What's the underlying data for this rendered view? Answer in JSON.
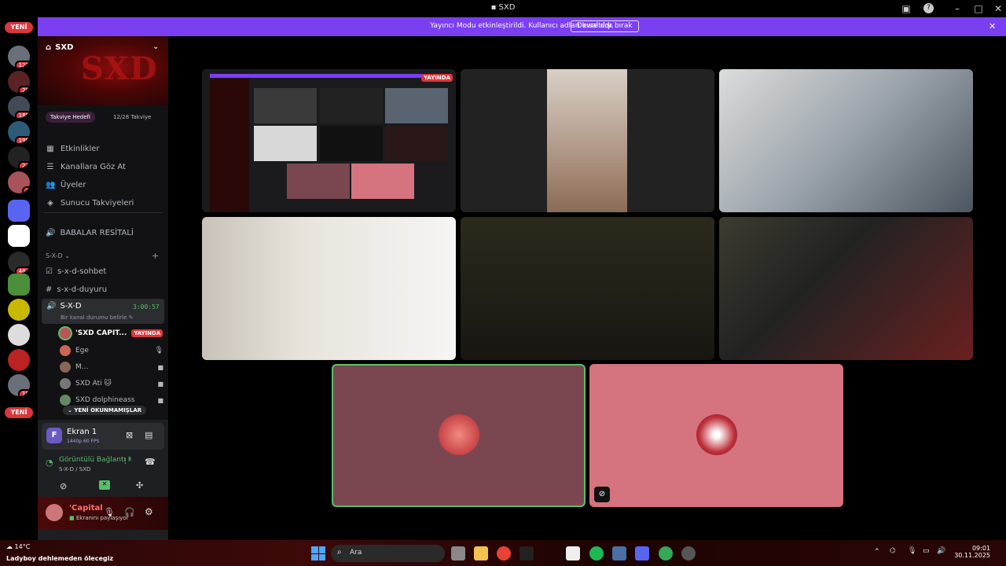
{
  "window": {
    "title": "SXD"
  },
  "banner": {
    "text": "Yayıncı Modu etkinleştirildi. Kullanıcı adları kısaltıldı.",
    "button": "Devre dışı bırak"
  },
  "rail": {
    "new_top": "YENİ",
    "new_bottom": "YENİ",
    "badges": [
      "121",
      "26",
      "188",
      "199",
      "24",
      "3",
      "484",
      "10"
    ]
  },
  "server": {
    "name": "SXD",
    "boost_goal": "Takviye Hedefi",
    "boost_count": "12/28 Takviye"
  },
  "menu": [
    "Etkinlikler",
    "Kanallara Göz At",
    "Üyeler",
    "Sunucu Takviyeleri"
  ],
  "voice_top": "BABALAR RESİTALİ",
  "category": "S-X-D",
  "channels": [
    "s-x-d-sohbet",
    "s-x-d-duyuru"
  ],
  "voice_channel": {
    "name": "S-X-D",
    "timer": "3:00:57",
    "status": "Bir kanal durumu belirle"
  },
  "voice_users": [
    {
      "name": "'SXD CAPIT...",
      "live": "YAYINDA"
    },
    {
      "name": "Ege"
    },
    {
      "name": "M..."
    },
    {
      "name": "SXD Ati 🐱"
    },
    {
      "name": "SXD dolphineass"
    }
  ],
  "unread": "YENİ OKUNMAMIŞLAR",
  "stream": {
    "title": "Ekran 1",
    "quality": "1440p 60 FPS"
  },
  "connection": {
    "status": "Görüntülü Bağlantı Kurul",
    "path": "S-X-D / SXD"
  },
  "user": {
    "name": "'Capital",
    "status": "Ekranını paylaşıyor"
  },
  "tiles": {
    "live_badge": "YAYINDA"
  },
  "taskbar": {
    "weather": "14°C",
    "news": "Ladyboy dehlemeden ölecegiz",
    "search": "Ara",
    "time": "09:01",
    "date": "30.11.2025"
  },
  "colors": {
    "accent": "#7b3ff2",
    "live": "#da373c",
    "tile_maroon": "#7a4750",
    "tile_pink": "#d5737e",
    "speaking": "#5bbd6a"
  }
}
